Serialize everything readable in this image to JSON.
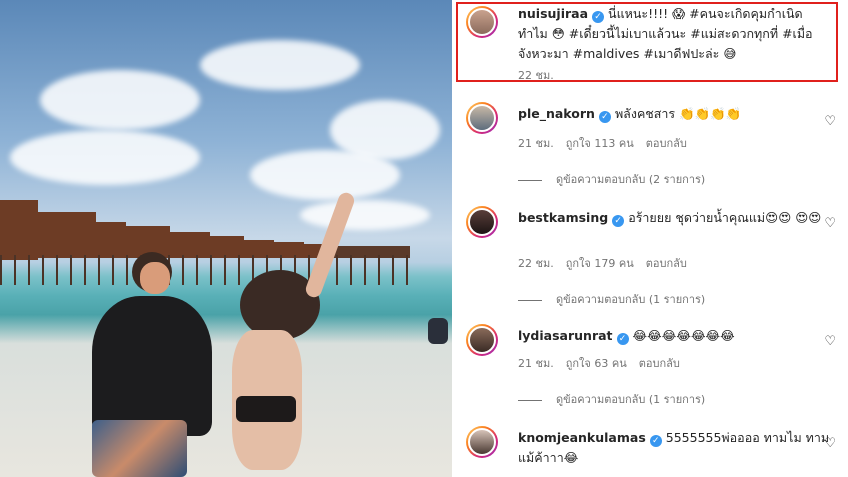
{
  "caption": {
    "username": "nuisujiraa",
    "text": "นี่แหนะ!!!! 😱 #คนจะเกิดคุมกำเนิดทำไม 😳 #เดี๋ยวนี้ไม่เบาแล้วนะ #แม่สะดวกทุกที่ #เมื่อจังหวะมา #maldives #เมาดีฟปะล่ะ 😅",
    "time": "22 ชม."
  },
  "comments": [
    {
      "username": "ple_nakorn",
      "text": "พลังคชสาร 👏👏👏👏",
      "time": "21 ชม.",
      "likes": "ถูกใจ 113 คน",
      "reply": "ตอบกลับ",
      "view_replies": "ดูข้อความตอบกลับ (2 รายการ)"
    },
    {
      "username": "bestkamsing",
      "text": "อร้ายยย ชุดว่ายน้ำคุณแม่😍😍 😍😍",
      "time": "22 ชม.",
      "likes": "ถูกใจ 179 คน",
      "reply": "ตอบกลับ",
      "view_replies": "ดูข้อความตอบกลับ (1 รายการ)"
    },
    {
      "username": "lydiasarunrat",
      "text": "😂😂😂😂😂😂😂",
      "time": "21 ชม.",
      "likes": "ถูกใจ 63 คน",
      "reply": "ตอบกลับ",
      "view_replies": "ดูข้อความตอบกลับ (1 รายการ)"
    },
    {
      "username": "knomjeankulamas",
      "text": "5555555พ่ออออ ทามไม ทามแม้ค้าาา😂",
      "time": "",
      "likes": "",
      "reply": "",
      "view_replies": ""
    }
  ],
  "icons": {
    "verified": "verified-badge-icon",
    "heart": "heart-outline-icon"
  },
  "colors": {
    "highlight_border": "#e0201c",
    "verified": "#3897f0"
  }
}
